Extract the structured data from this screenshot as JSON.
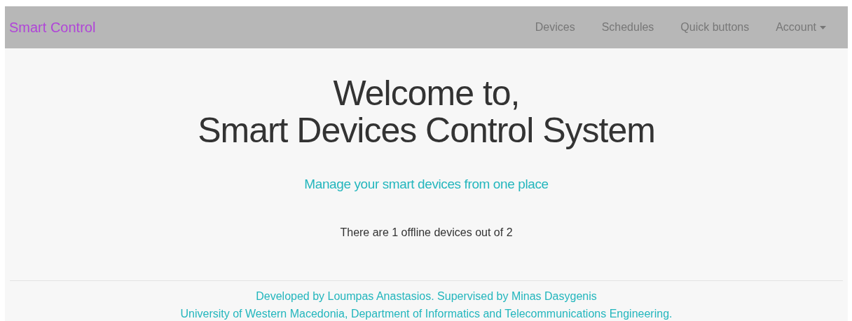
{
  "navbar": {
    "brand": "Smart Control",
    "links": [
      {
        "label": "Devices",
        "kind": "link"
      },
      {
        "label": "Schedules",
        "kind": "link"
      },
      {
        "label": "Quick buttons",
        "kind": "link"
      },
      {
        "label": "Account",
        "kind": "dropdown"
      }
    ]
  },
  "hero": {
    "title_lines": [
      "Welcome to,",
      "Smart Devices Control System"
    ],
    "subtitle": "Manage your smart devices from one place",
    "status": "There are 1 offline devices out of 2"
  },
  "footer": {
    "lines": [
      "Developed by Loumpas Anastasios. Supervised by Minas Dasygenis",
      "University of Western Macedonia, Department of Informatics and Telecommunications Engineering."
    ]
  }
}
